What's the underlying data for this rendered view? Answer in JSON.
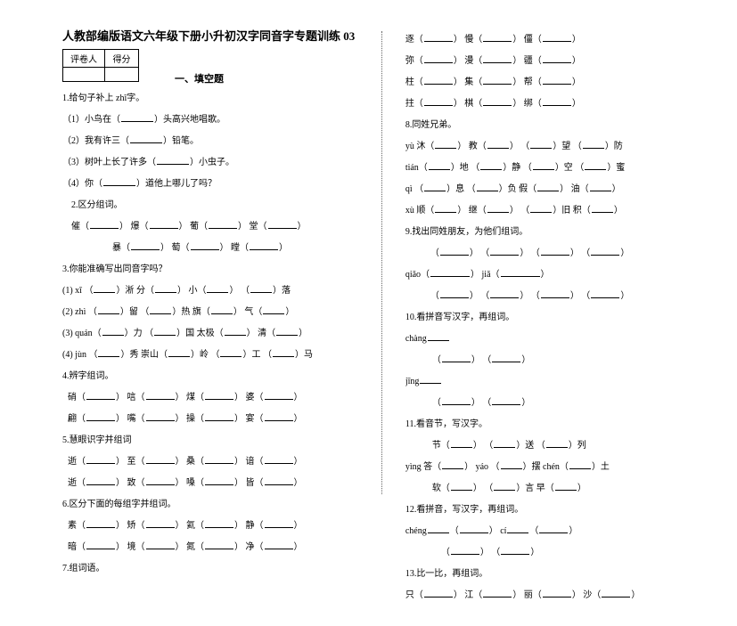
{
  "title": "人教部编版语文六年级下册小升初汉字同音字专题训练 03",
  "score_table": {
    "col1": "评卷人",
    "col2": "得分"
  },
  "section1": "一、填空题",
  "left": {
    "q1": {
      "h": "1.给句子补上 zhī字。",
      "a": "（1）小鸟在（",
      "a2": "）头高兴地唱歌。",
      "b": "（2）我有许三（",
      "b2": "）铅笔。",
      "c": "（3）树叶上长了许多（",
      "c2": "）小虫子。",
      "d": "（4）你（",
      "d2": "）道他上哪儿了吗？"
    },
    "q2": {
      "h": "2.区分组词。",
      "a": "催（",
      "b": "）  爆（",
      "c": "）  葡（",
      "d": "）  堂（",
      "e": "）",
      "f": "暴（",
      "g": "）  萄（",
      "h2": "）  瞠（",
      "i": "）"
    },
    "q3": {
      "h": "3.你能准确写出同音字吗？",
      "a": "(1) xī  （",
      "a2": "）淅  分（",
      "a3": "）  小（",
      "a4": "）  （",
      "a5": "）落",
      "b": "(2) zhì （",
      "b2": "）留  （",
      "b3": "）热  旗（",
      "b4": "）  气（",
      "b5": "）",
      "c": "(3) quán（",
      "c2": "）力  （",
      "c3": "）国  太极（",
      "c4": "）  清（",
      "c5": "）",
      "d": "(4) jùn （",
      "d2": "）秀  崇山（",
      "d3": "）岭  （",
      "d4": "）工  （",
      "d5": "）马"
    },
    "q4": {
      "h": "4.辨字组词。",
      "a": "硝（",
      "b": "）  唁（",
      "c": "）  煤（",
      "d": "）  婆（",
      "e": "）",
      "f": "翩（",
      "g": "）  嘴（",
      "h2": "）  操（",
      "i": "）  宴（",
      "j": "）"
    },
    "q5": {
      "h": "5.慧眼识字并组词",
      "a": "逝（",
      "b": "）  至（",
      "c": "）  桑（",
      "d": "）  谙（",
      "e": "）",
      "f": "逝（",
      "g": "）  致（",
      "h2": "）  嗓（",
      "i": "）  皆（",
      "j": "）"
    },
    "q6": {
      "h": "6.区分下面的每组字并组词。",
      "a": "素（",
      "b": "）  矫（",
      "c": "）  氦（",
      "d": "）  静（",
      "e": "）",
      "f": "暗（",
      "g": "）  境（",
      "h2": "）  氮（",
      "i": "）  净（",
      "j": "）"
    },
    "q7": {
      "h": "7.组词语。"
    }
  },
  "right": {
    "r1": {
      "a": "逐（",
      "b": "）  慢（",
      "c": "）  僵（",
      "d": "）",
      "e": "弥（",
      "f": "）  漫（",
      "g": "）  疆（",
      "h": "）",
      "i": "柱（",
      "j": "）  集（",
      "k": "）  帮（",
      "l": "）",
      "m": "拄（",
      "n": "）  棋（",
      "o": "）  绑（",
      "p": "）"
    },
    "r8": {
      "h": "8.同姓兄弟。",
      "a": "yù  沐（",
      "a2": "）  教（",
      "a3": "）  （",
      "a4": "）望  （",
      "a5": "）防",
      "b": "tián（",
      "b2": "）地  （",
      "b3": "）静  （",
      "b4": "）空  （",
      "b5": "）蜜",
      "c": "qì  （",
      "c2": "）息  （",
      "c3": "）负  假（",
      "c4": "）  油（",
      "c5": "）",
      "d": "xù  顺（",
      "d2": "）  继（",
      "d3": "）  （",
      "d4": "）旧  积（",
      "d5": "）"
    },
    "r9": {
      "h": "9.找出同姓朋友，为他们组词。",
      "a": "（",
      "b": "）  （",
      "c": "）  （",
      "d": "）  （",
      "e": "）",
      "f": "qiǎo（",
      "g": "）  jiǎ（",
      "h2": "）",
      "i": "（",
      "j": "）  （",
      "k": "）  （",
      "l": "）  （",
      "m": "）"
    },
    "r10": {
      "h": "10.看拼音写汉字，再组词。",
      "a": "chàng",
      "b": "（",
      "c": "）  （",
      "d": "）",
      "e": "jīng",
      "f": "（",
      "g": "）  （",
      "h2": "）"
    },
    "r11": {
      "h": "11.看音节，写汉字。",
      "a": "节（",
      "a2": "）  （",
      "a3": "）送  （",
      "a4": "）列",
      "b": "yìng 答（",
      "b2": "）  yáo  （",
      "b3": "）摆  chén（",
      "b4": "）土",
      "c": "软（",
      "c2": "）  （",
      "c3": "）言  早（",
      "c4": "）"
    },
    "r12": {
      "h": "12.看拼音，写汉字，再组词。",
      "a": "chéng",
      "a2": "（",
      "a3": "）  cí",
      "a4": "（",
      "a5": "）",
      "b": "（",
      "c": "）  （",
      "d": "）"
    },
    "r13": {
      "h": "13.比一比，再组词。",
      "a": "只（",
      "b": "）  江（",
      "c": "）  丽（",
      "d": "）  沙（",
      "e": "）"
    }
  }
}
